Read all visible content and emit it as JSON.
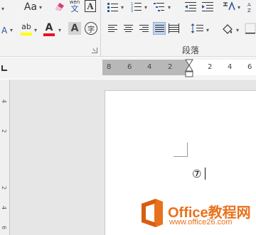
{
  "ribbon": {
    "group_label": "段落",
    "row1": {
      "change_case_label": "Aa",
      "phonetic_top": "wén",
      "phonetic_bottom": "文",
      "char_border_label": "A"
    },
    "row2": {
      "text_effect_label": "A",
      "highlight_label": "ab",
      "font_color_label": "A",
      "font_color_hex": "#e81123",
      "highlight_hex": "#ffff00",
      "enclose_char_label": "字"
    },
    "alignment_active": "distributed"
  },
  "ruler": {
    "numbers": [
      "8",
      "6",
      "4",
      "2",
      "2",
      "4",
      "6"
    ],
    "vertical_numbers": [
      "4",
      "2",
      "2",
      "4",
      "6"
    ]
  },
  "document": {
    "text": "⑦"
  },
  "watermark": {
    "title": "Office教程网",
    "url": "www.office26.com",
    "color": "#e8721c"
  }
}
